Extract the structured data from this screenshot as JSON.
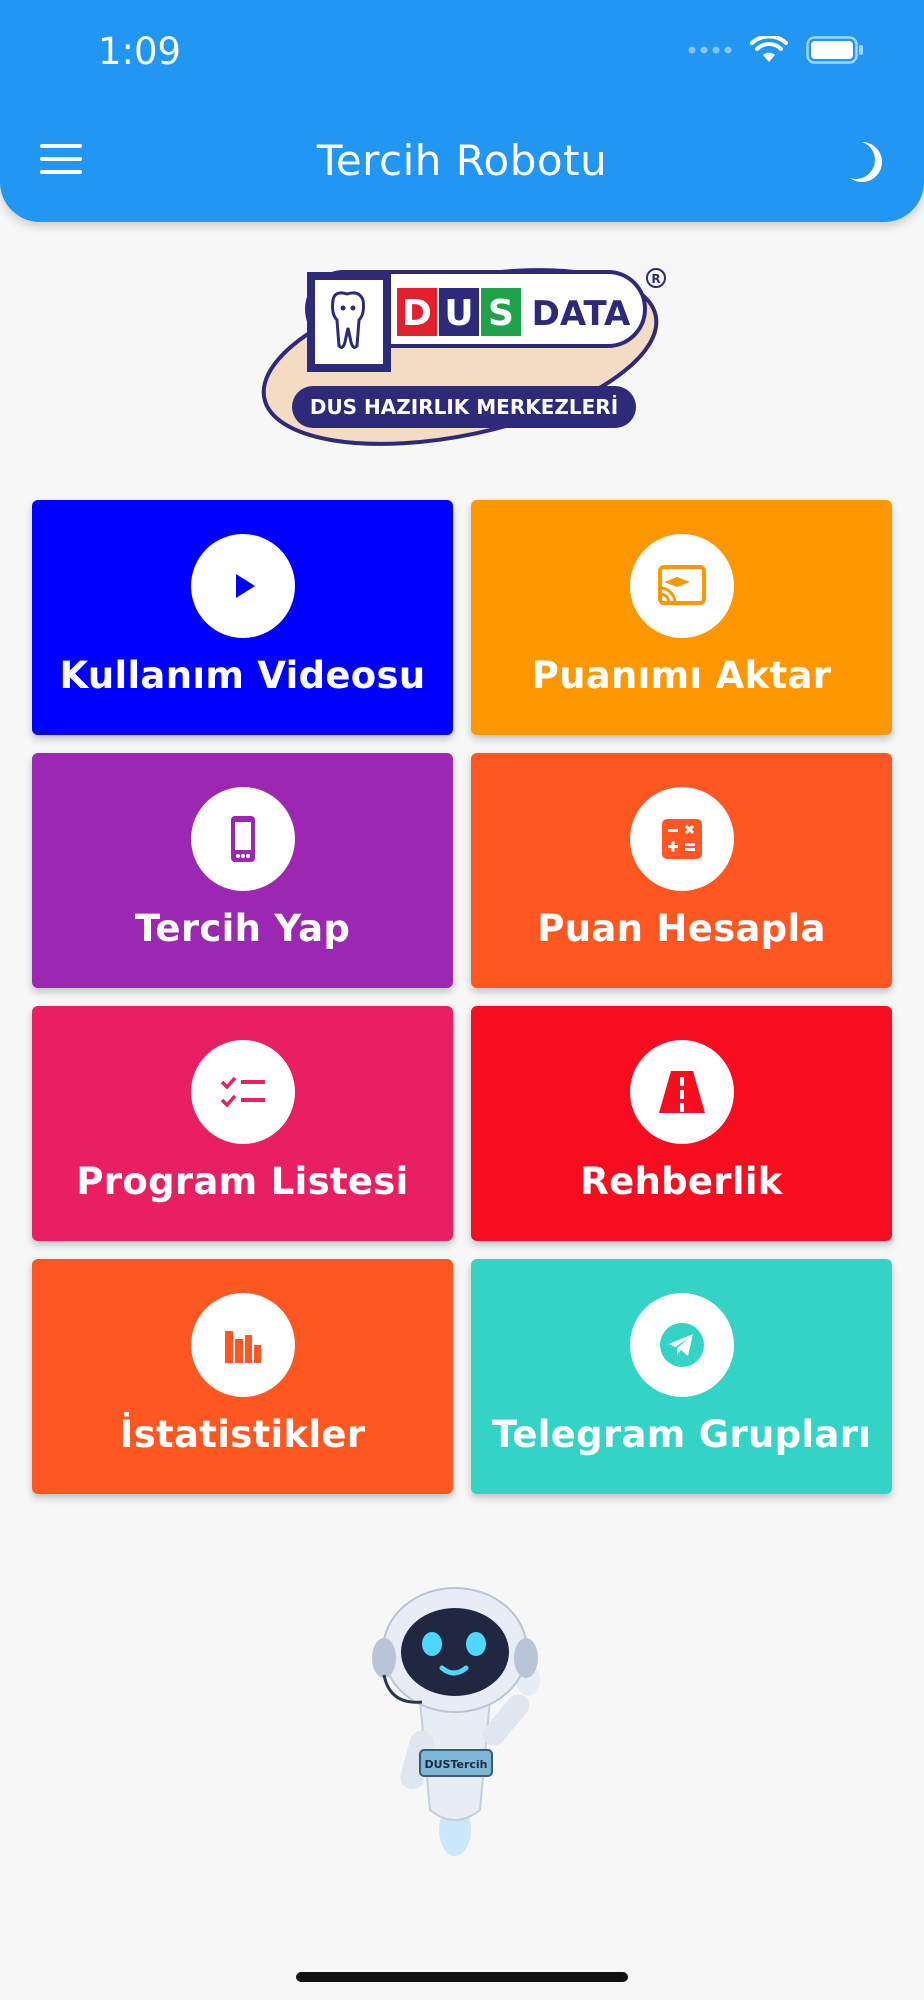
{
  "status_bar": {
    "time": "1:09"
  },
  "header": {
    "title": "Tercih Robotu"
  },
  "logo": {
    "brand_top": "DUS DATA",
    "brand_sub": "DUS HAZIRLIK MERKEZLERİ"
  },
  "tiles": [
    {
      "label": "Kullanım Videosu",
      "color": "#0000ff",
      "icon": "play-icon"
    },
    {
      "label": "Puanımı Aktar",
      "color": "#ff9800",
      "icon": "cast-education-icon"
    },
    {
      "label": "Tercih Yap",
      "color": "#9c27b0",
      "icon": "phone-icon"
    },
    {
      "label": "Puan Hesapla",
      "color": "#ff5722",
      "icon": "calculator-icon"
    },
    {
      "label": "Program Listesi",
      "color": "#e91e63",
      "icon": "checklist-icon"
    },
    {
      "label": "Rehberlik",
      "color": "#f70d1f",
      "icon": "road-icon"
    },
    {
      "label": "İstatistikler",
      "color": "#ff5722",
      "icon": "bar-chart-icon"
    },
    {
      "label": "Telegram Grupları",
      "color": "#33d4c6",
      "icon": "telegram-icon"
    }
  ],
  "robot": {
    "badge": "DUSTercih"
  }
}
